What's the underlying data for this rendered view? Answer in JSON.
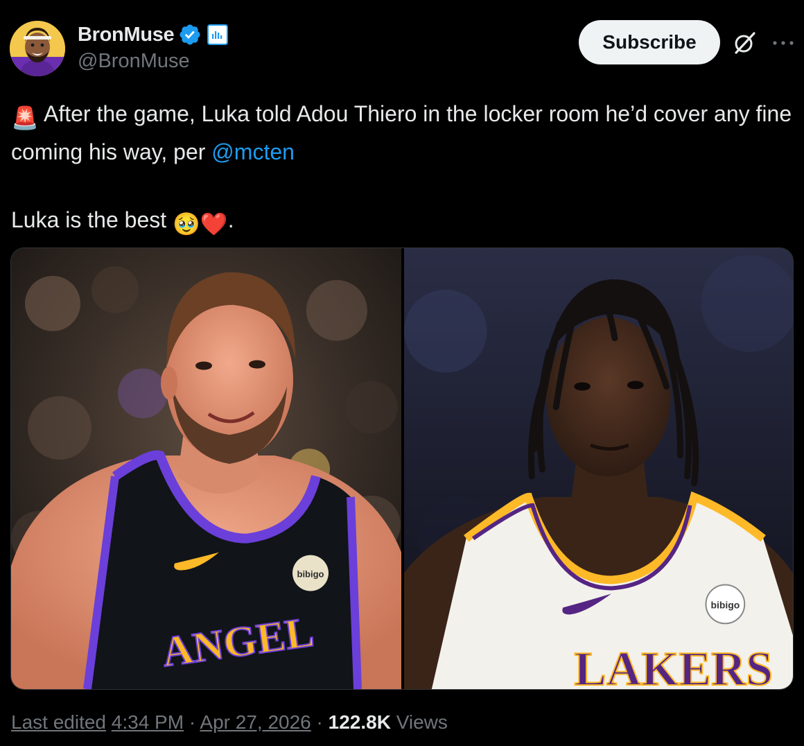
{
  "author": {
    "display_name": "BronMuse",
    "handle": "@BronMuse",
    "verified_icon": "verified-badge-icon",
    "affiliate_icon": "analytics-badge-icon"
  },
  "actions": {
    "subscribe_label": "Subscribe",
    "grok_icon": "grok-icon",
    "more_icon": "more-icon"
  },
  "tweet": {
    "line1_emoji": "🚨",
    "line1_text": "After the game, Luka told Adou Thiero in the locker room he’d cover any fine coming his way, per ",
    "mention": "@mcten",
    "line2_text": "Luka is the best ",
    "line2_emoji_1": "🥹",
    "line2_emoji_2": "❤️",
    "line2_end": "."
  },
  "media": {
    "photos": [
      {
        "jersey_text": "LOS ANGELES",
        "sponsor": "bibigo"
      },
      {
        "jersey_text": "LAKERS",
        "sponsor": "bibigo"
      }
    ]
  },
  "footer": {
    "edited_label": "Last edited",
    "time": "4:34 PM",
    "separator": " · ",
    "date": "Apr 27, 2026",
    "views_count": "122.8K",
    "views_label": "Views"
  },
  "colors": {
    "background": "#000000",
    "text": "#e7e9ea",
    "muted": "#71767b",
    "accent": "#1d9bf0",
    "lakers_purple": "#552583",
    "lakers_gold": "#FDB927"
  }
}
